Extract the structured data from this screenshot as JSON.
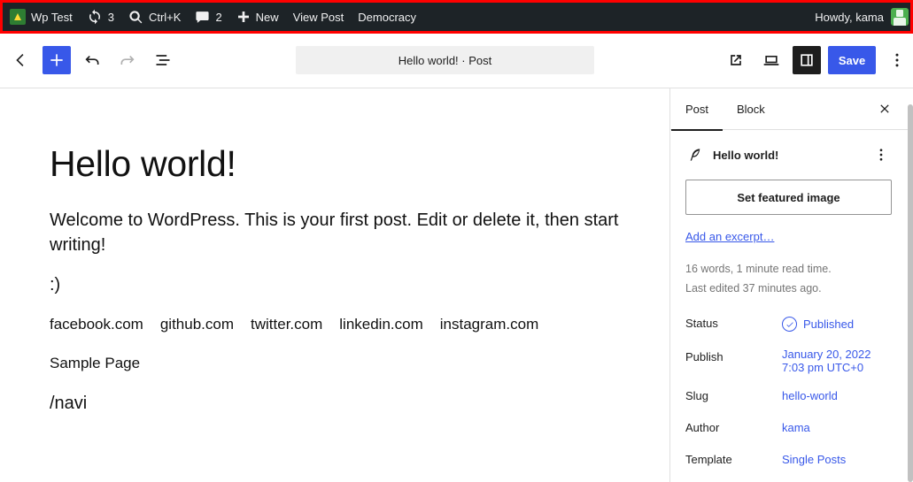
{
  "adminbar": {
    "site_name": "Wp Test",
    "updates_count": "3",
    "search_shortcut": "Ctrl+K",
    "comments_count": "2",
    "new_label": "New",
    "view_post_label": "View Post",
    "democracy_label": "Democracy",
    "howdy": "Howdy, kama"
  },
  "header": {
    "doc_title": "Hello world! · Post",
    "save_label": "Save"
  },
  "post": {
    "title": "Hello world!",
    "paragraph": "Welcome to WordPress. This is your first post. Edit or delete it, then start writing!",
    "smiley": ":)",
    "social_links": [
      "facebook.com",
      "github.com",
      "twitter.com",
      "linkedin.com",
      "instagram.com"
    ],
    "sample_page": "Sample Page",
    "navi": "/navi"
  },
  "sidebar": {
    "tab_post": "Post",
    "tab_block": "Block",
    "post_title": "Hello world!",
    "featured_image_label": "Set featured image",
    "excerpt_link": "Add an excerpt…",
    "word_count": "16 words, 1 minute read time.",
    "last_edited": "Last edited 37 minutes ago.",
    "status_label": "Status",
    "status_value": "Published",
    "publish_label": "Publish",
    "publish_date": "January 20, 2022",
    "publish_time": "7:03 pm UTC+0",
    "slug_label": "Slug",
    "slug_value": "hello-world",
    "author_label": "Author",
    "author_value": "kama",
    "template_label": "Template",
    "template_value": "Single Posts"
  },
  "colors": {
    "accent": "#3858e9",
    "adminbar_bg": "#1d2327",
    "highlight_border": "#ff0000"
  }
}
